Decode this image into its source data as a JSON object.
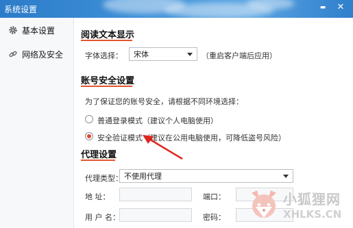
{
  "window": {
    "title": "系统设置",
    "minimize_glyph": "▬",
    "close_glyph": "✕"
  },
  "sidebar": {
    "items": [
      {
        "label": "基本设置",
        "icon": "gear-icon"
      },
      {
        "label": "网络及安全",
        "icon": "link-icon"
      }
    ]
  },
  "reading": {
    "section_title": "阅读文本显示",
    "font_label": "字体选择：",
    "font_value": "宋体",
    "font_note": "（重启客户端后应用）"
  },
  "account": {
    "section_title": "账号安全设置",
    "description": "为了保证您的账号安全，请根据不同环境选择：",
    "options": [
      {
        "label": "普通登录模式（建议个人电脑使用）",
        "checked": false
      },
      {
        "label": "安全验证模式（建议在公用电脑使用，可降低盗号风险）",
        "checked": true
      }
    ]
  },
  "proxy": {
    "section_title": "代理设置",
    "type_label": "代理类型：",
    "type_value": "不使用代理",
    "address_label": "地    址：",
    "port_label": "端口：",
    "username_label": "用 户 名：",
    "password_label": "密码："
  },
  "watermark": {
    "cn": "小狐狸网",
    "en": "XHLKS.CN"
  },
  "colors": {
    "accent": "#e5542b",
    "titlebar": "#3f90d8"
  }
}
